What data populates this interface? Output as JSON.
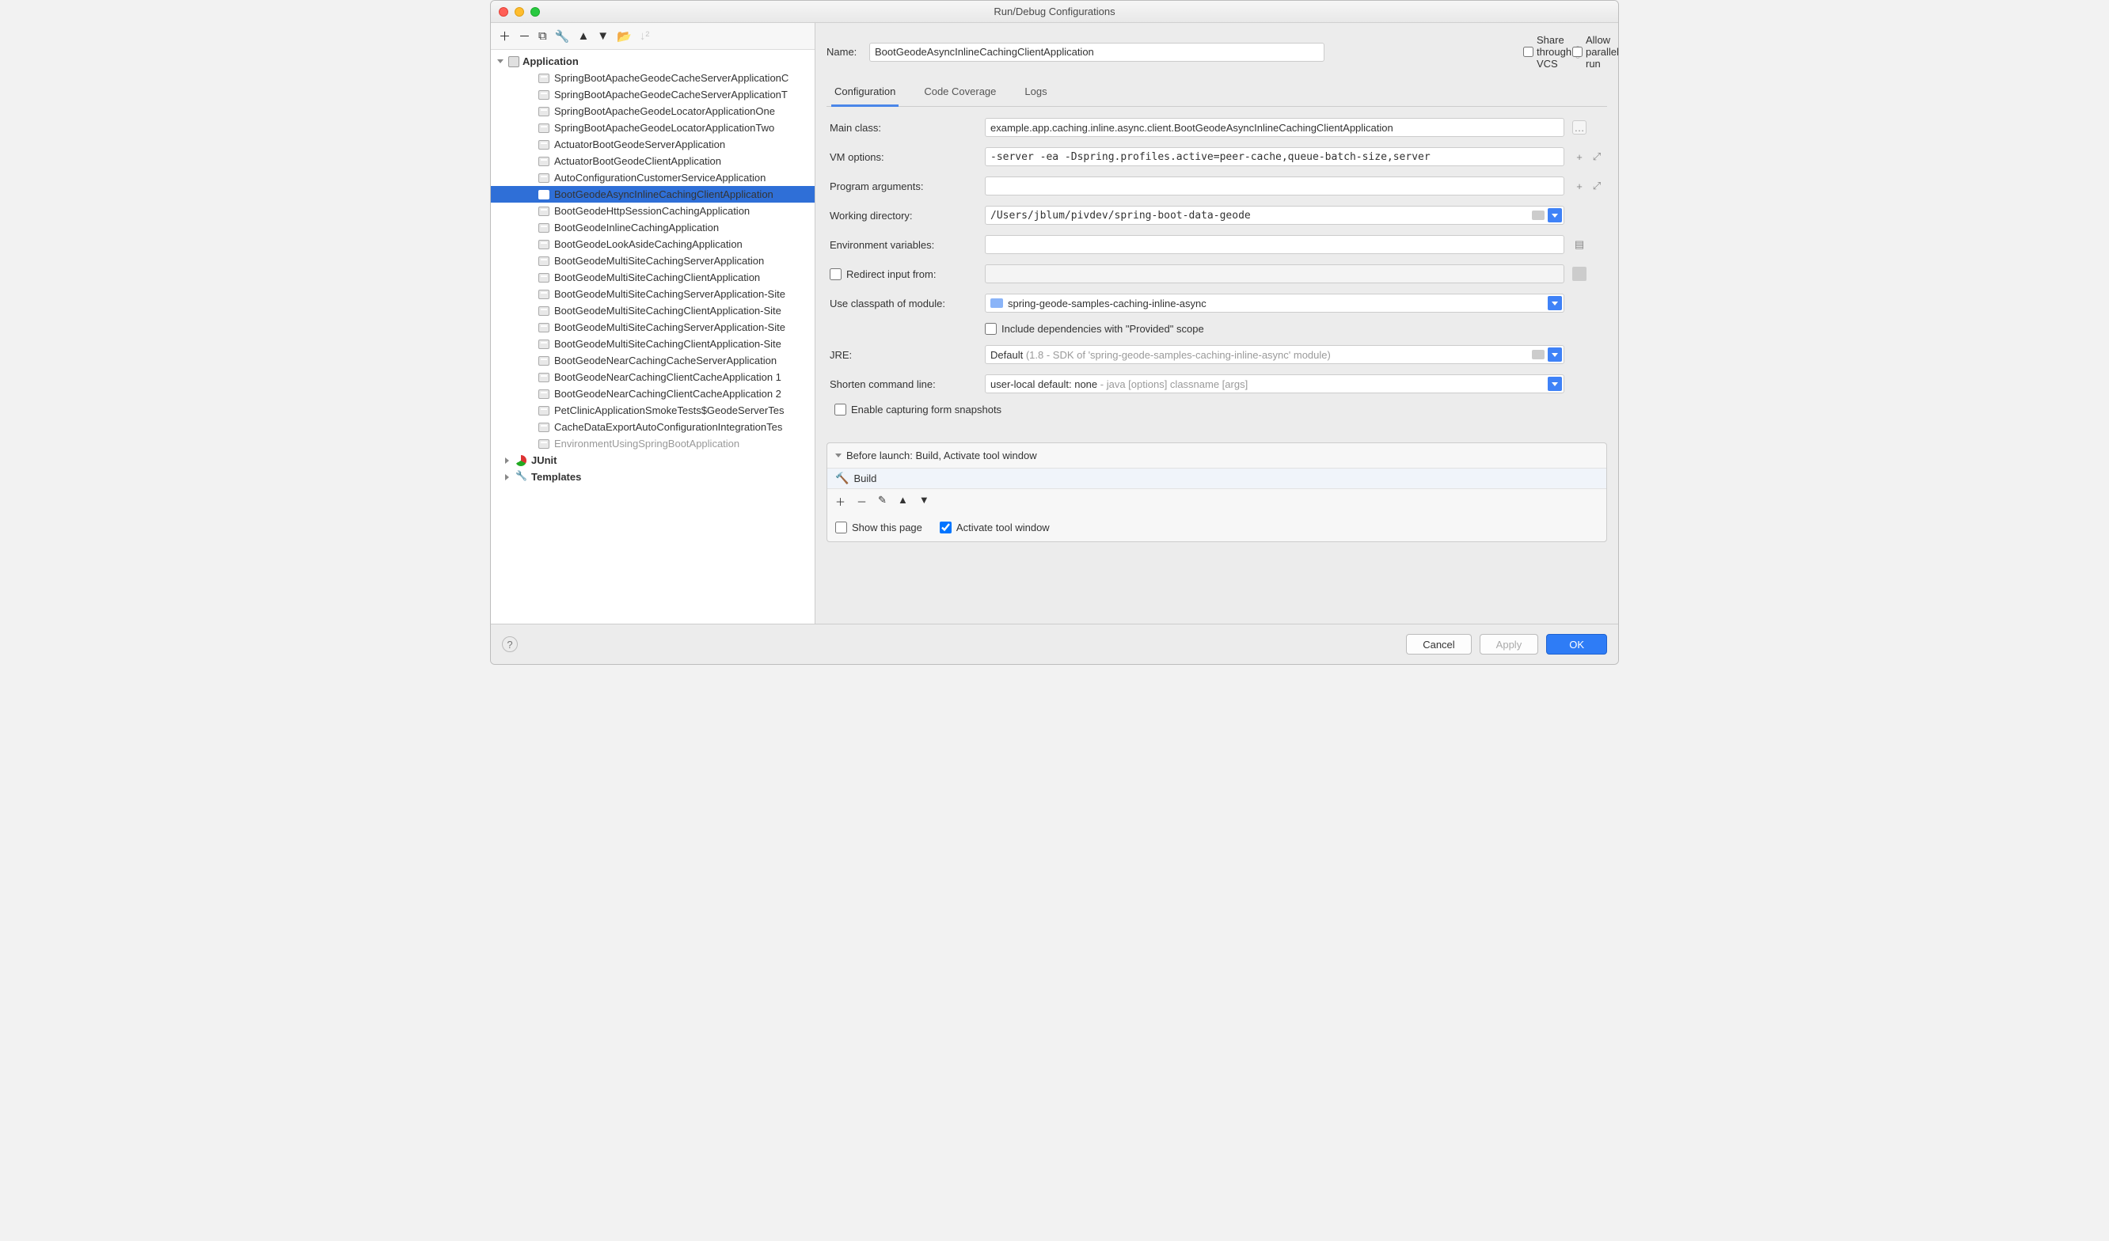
{
  "window": {
    "title": "Run/Debug Configurations"
  },
  "tree": {
    "application_label": "Application",
    "items": [
      "SpringBootApacheGeodeCacheServerApplicationC",
      "SpringBootApacheGeodeCacheServerApplicationT",
      "SpringBootApacheGeodeLocatorApplicationOne",
      "SpringBootApacheGeodeLocatorApplicationTwo",
      "ActuatorBootGeodeServerApplication",
      "ActuatorBootGeodeClientApplication",
      "AutoConfigurationCustomerServiceApplication",
      "BootGeodeAsyncInlineCachingClientApplication",
      "BootGeodeHttpSessionCachingApplication",
      "BootGeodeInlineCachingApplication",
      "BootGeodeLookAsideCachingApplication",
      "BootGeodeMultiSiteCachingServerApplication",
      "BootGeodeMultiSiteCachingClientApplication",
      "BootGeodeMultiSiteCachingServerApplication-Site",
      "BootGeodeMultiSiteCachingClientApplication-Site",
      "BootGeodeMultiSiteCachingServerApplication-Site",
      "BootGeodeMultiSiteCachingClientApplication-Site",
      "BootGeodeNearCachingCacheServerApplication",
      "BootGeodeNearCachingClientCacheApplication 1",
      "BootGeodeNearCachingClientCacheApplication 2",
      "PetClinicApplicationSmokeTests$GeodeServerTes",
      "CacheDataExportAutoConfigurationIntegrationTes",
      "EnvironmentUsingSpringBootApplication"
    ],
    "selected_index": 7,
    "dim_index": 22,
    "junit_label": "JUnit",
    "templates_label": "Templates"
  },
  "name": {
    "label": "Name:",
    "value": "BootGeodeAsyncInlineCachingClientApplication"
  },
  "share_vcs": "Share through VCS",
  "allow_parallel": "Allow parallel run",
  "tabs": {
    "configuration": "Configuration",
    "code_coverage": "Code Coverage",
    "logs": "Logs"
  },
  "form": {
    "main_class_label": "Main class:",
    "main_class_value": "example.app.caching.inline.async.client.BootGeodeAsyncInlineCachingClientApplication",
    "vm_options_label": "VM options:",
    "vm_options_value": "-server -ea -Dspring.profiles.active=peer-cache,queue-batch-size,server",
    "program_args_label": "Program arguments:",
    "program_args_value": "",
    "working_dir_label": "Working directory:",
    "working_dir_value": "/Users/jblum/pivdev/spring-boot-data-geode",
    "env_vars_label": "Environment variables:",
    "env_vars_value": "",
    "redirect_label": "Redirect input from:",
    "redirect_value": "",
    "module_label": "Use classpath of module:",
    "module_value": "spring-geode-samples-caching-inline-async",
    "include_provided": "Include dependencies with \"Provided\" scope",
    "jre_label": "JRE:",
    "jre_value_prefix": "Default",
    "jre_value_suffix": " (1.8 - SDK of 'spring-geode-samples-caching-inline-async' module)",
    "shorten_label": "Shorten command line:",
    "shorten_value_prefix": "user-local default: none",
    "shorten_value_suffix": " - java [options] classname [args]",
    "snapshots_label": "Enable capturing form snapshots"
  },
  "before_launch": {
    "header": "Before launch: Build, Activate tool window",
    "build": "Build",
    "show_page": "Show this page",
    "activate": "Activate tool window"
  },
  "footer": {
    "cancel": "Cancel",
    "apply": "Apply",
    "ok": "OK"
  }
}
